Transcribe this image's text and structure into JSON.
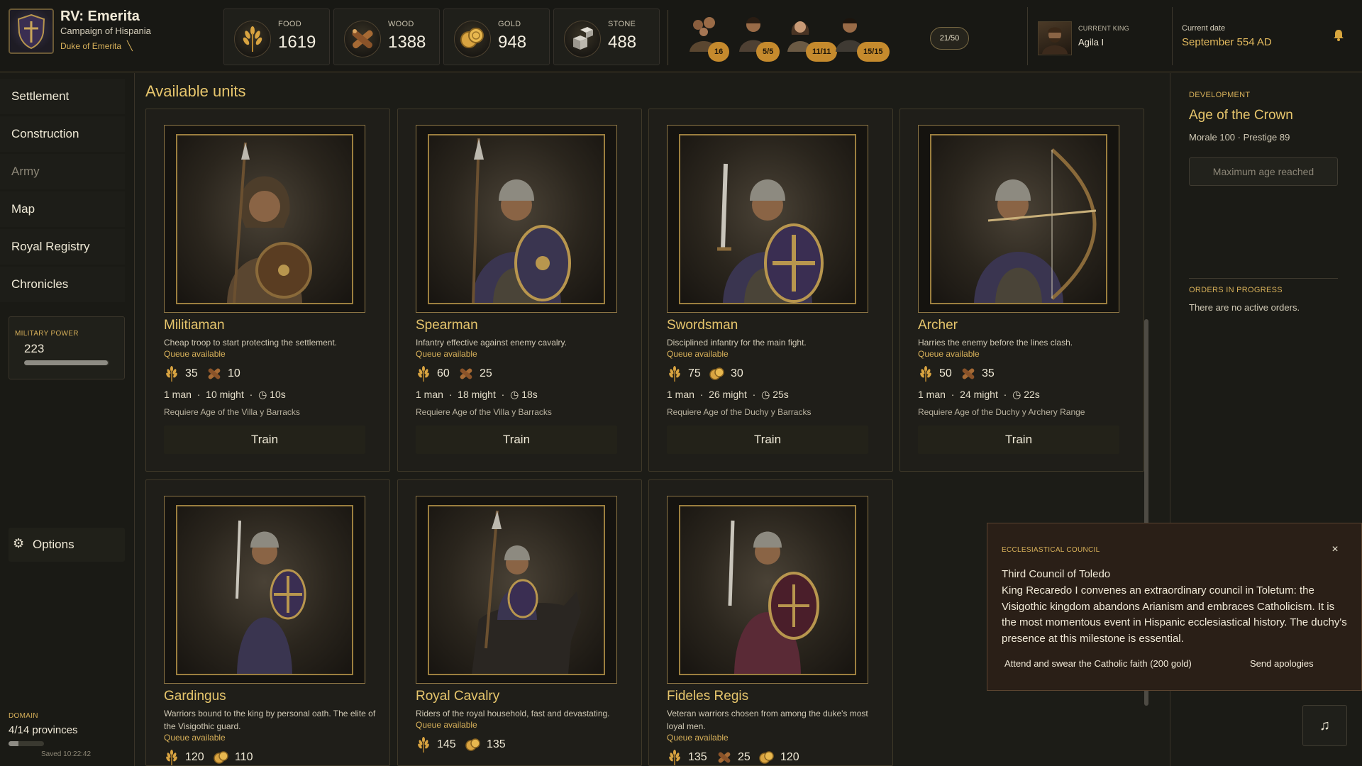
{
  "header": {
    "title": "RV: Emerita",
    "campaign": "Campaign of Hispania",
    "duke": "Duke of Emerita",
    "resources": [
      {
        "label": "FOOD",
        "value": "1619",
        "icon": "wheat-icon"
      },
      {
        "label": "WOOD",
        "value": "1388",
        "icon": "logs-icon"
      },
      {
        "label": "GOLD",
        "value": "948",
        "icon": "coins-icon"
      },
      {
        "label": "STONE",
        "value": "488",
        "icon": "stone-blocks-icon"
      }
    ],
    "population": [
      {
        "badge": "16",
        "icon": "family-icon"
      },
      {
        "badge": "5/5",
        "icon": "worker-icon"
      },
      {
        "badge": "11/11",
        "icon": "woman-icon"
      },
      {
        "badge": "15/15",
        "icon": "soldier-icon"
      }
    ],
    "population_total": "21/50",
    "king_label": "CURRENT KING",
    "king_name": "Agila I",
    "date_label": "Current date",
    "date_value": "September 554 AD"
  },
  "sidebar": {
    "items": [
      {
        "label": "Settlement",
        "enabled": true
      },
      {
        "label": "Construction",
        "enabled": true
      },
      {
        "label": "Army",
        "enabled": false
      },
      {
        "label": "Map",
        "enabled": true
      },
      {
        "label": "Royal Registry",
        "enabled": true
      },
      {
        "label": "Chronicles",
        "enabled": true
      }
    ],
    "military_power_label": "MILITARY POWER",
    "military_power_value": "223",
    "military_power_level": 0.98,
    "options_label": "Options",
    "domain_label": "DOMAIN",
    "domain_value": "4/14 provinces",
    "domain_level": 0.2857,
    "saved": "Saved 10:22:42"
  },
  "main": {
    "title": "Available units",
    "units": [
      {
        "name": "Militiaman",
        "desc": "Cheap troop to start protecting the settlement.",
        "queue": "Queue available",
        "costs": [
          {
            "icon": "wheat-icon",
            "value": "35"
          },
          {
            "icon": "logs-icon",
            "value": "10"
          }
        ],
        "men": "1 man",
        "might": "10 might",
        "time": "10s",
        "req": "Requiere Age of the Villa y Barracks",
        "train": "Train"
      },
      {
        "name": "Spearman",
        "desc": "Infantry effective against enemy cavalry.",
        "queue": "Queue available",
        "costs": [
          {
            "icon": "wheat-icon",
            "value": "60"
          },
          {
            "icon": "logs-icon",
            "value": "25"
          }
        ],
        "men": "1 man",
        "might": "18 might",
        "time": "18s",
        "req": "Requiere Age of the Villa y Barracks",
        "train": "Train"
      },
      {
        "name": "Swordsman",
        "desc": "Disciplined infantry for the main fight.",
        "queue": "Queue available",
        "costs": [
          {
            "icon": "wheat-icon",
            "value": "75"
          },
          {
            "icon": "coins-icon",
            "value": "30"
          }
        ],
        "men": "1 man",
        "might": "26 might",
        "time": "25s",
        "req": "Requiere Age of the Duchy y Barracks",
        "train": "Train"
      },
      {
        "name": "Archer",
        "desc": "Harries the enemy before the lines clash.",
        "queue": "Queue available",
        "costs": [
          {
            "icon": "wheat-icon",
            "value": "50"
          },
          {
            "icon": "logs-icon",
            "value": "35"
          }
        ],
        "men": "1 man",
        "might": "24 might",
        "time": "22s",
        "req": "Requiere Age of the Duchy y Archery Range",
        "train": "Train"
      },
      {
        "name": "Gardingus",
        "desc": "Warriors bound to the king by personal oath. The elite of the Visigothic guard.",
        "queue": "Queue available",
        "costs": [
          {
            "icon": "wheat-icon",
            "value": "120"
          },
          {
            "icon": "coins-icon",
            "value": "110"
          }
        ]
      },
      {
        "name": "Royal Cavalry",
        "desc": "Riders of the royal household, fast and devastating.",
        "queue": "Queue available",
        "costs": [
          {
            "icon": "wheat-icon",
            "value": "145"
          },
          {
            "icon": "coins-icon",
            "value": "135"
          }
        ]
      },
      {
        "name": "Fideles Regis",
        "desc": "Veteran warriors chosen from among the duke's most loyal men.",
        "queue": "Queue available",
        "costs": [
          {
            "icon": "wheat-icon",
            "value": "135"
          },
          {
            "icon": "logs-icon",
            "value": "25"
          },
          {
            "icon": "coins-icon",
            "value": "120"
          }
        ]
      }
    ]
  },
  "right": {
    "dev_label": "DEVELOPMENT",
    "dev_age": "Age of the Crown",
    "dev_stats": "Morale 100 · Prestige 89",
    "dev_button": "Maximum age reached",
    "orders_label": "ORDERS IN PROGRESS",
    "orders_text": "There are no active orders."
  },
  "event": {
    "label": "ECCLESIASTICAL COUNCIL",
    "close": "×",
    "title": "Third Council of Toledo",
    "body": "King Recaredo I convenes an extraordinary council in Toletum: the Visigothic kingdom abandons Arianism and embraces Catholicism. It is the most momentous event in Hispanic ecclesiastical history. The duchy's presence at this milestone is essential.",
    "option1": "Attend and swear the Catholic faith (200 gold)",
    "option2": "Send apologies"
  },
  "music_icon": "♫",
  "colors": {
    "accent_gold": "#d8b15a",
    "title_gold": "#e6c56c",
    "badge_orange": "#c58a2d",
    "background": "#1c1c17"
  }
}
